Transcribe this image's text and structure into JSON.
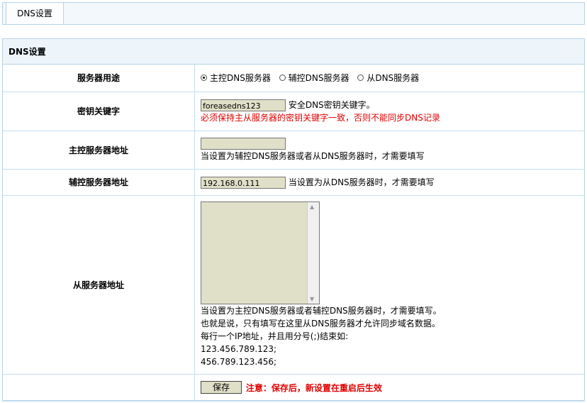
{
  "tab": {
    "label": "DNS设置"
  },
  "panel": {
    "title": "DNS设置"
  },
  "rows": {
    "usage": {
      "label": "服务器用途",
      "options": [
        "主控DNS服务器",
        "辅控DNS服务器",
        "从DNS服务器"
      ],
      "selected": "主控DNS服务器"
    },
    "key": {
      "label": "密钥关键字",
      "value": "foreasedns123",
      "hint": "安全DNS密钥关键字。",
      "warning": "必须保持主从服务器的密钥关键字一致，否则不能同步DNS记录"
    },
    "master": {
      "label": "主控服务器地址",
      "value": "",
      "hint": "当设置为辅控DNS服务器或者从DNS服务器时，才需要填写"
    },
    "aux": {
      "label": "辅控服务器地址",
      "value": "192.168.0.111",
      "hint": "当设置为从DNS服务器时，才需要填写"
    },
    "slave": {
      "label": "从服务器地址",
      "value": "",
      "hint1": "当设置为主控DNS服务器或者辅控DNS服务器时，才需要填写。",
      "hint2": "也就是说，只有填写在这里从DNS服务器才允许同步域名数据。",
      "hint3": "每行一个IP地址，并且用分号(;)结束如:",
      "example1": "123.456.789.123;",
      "example2": "456.789.123.456;"
    }
  },
  "save": {
    "label": "保存",
    "note": "注意：保存后，新设置在重启后生效"
  }
}
